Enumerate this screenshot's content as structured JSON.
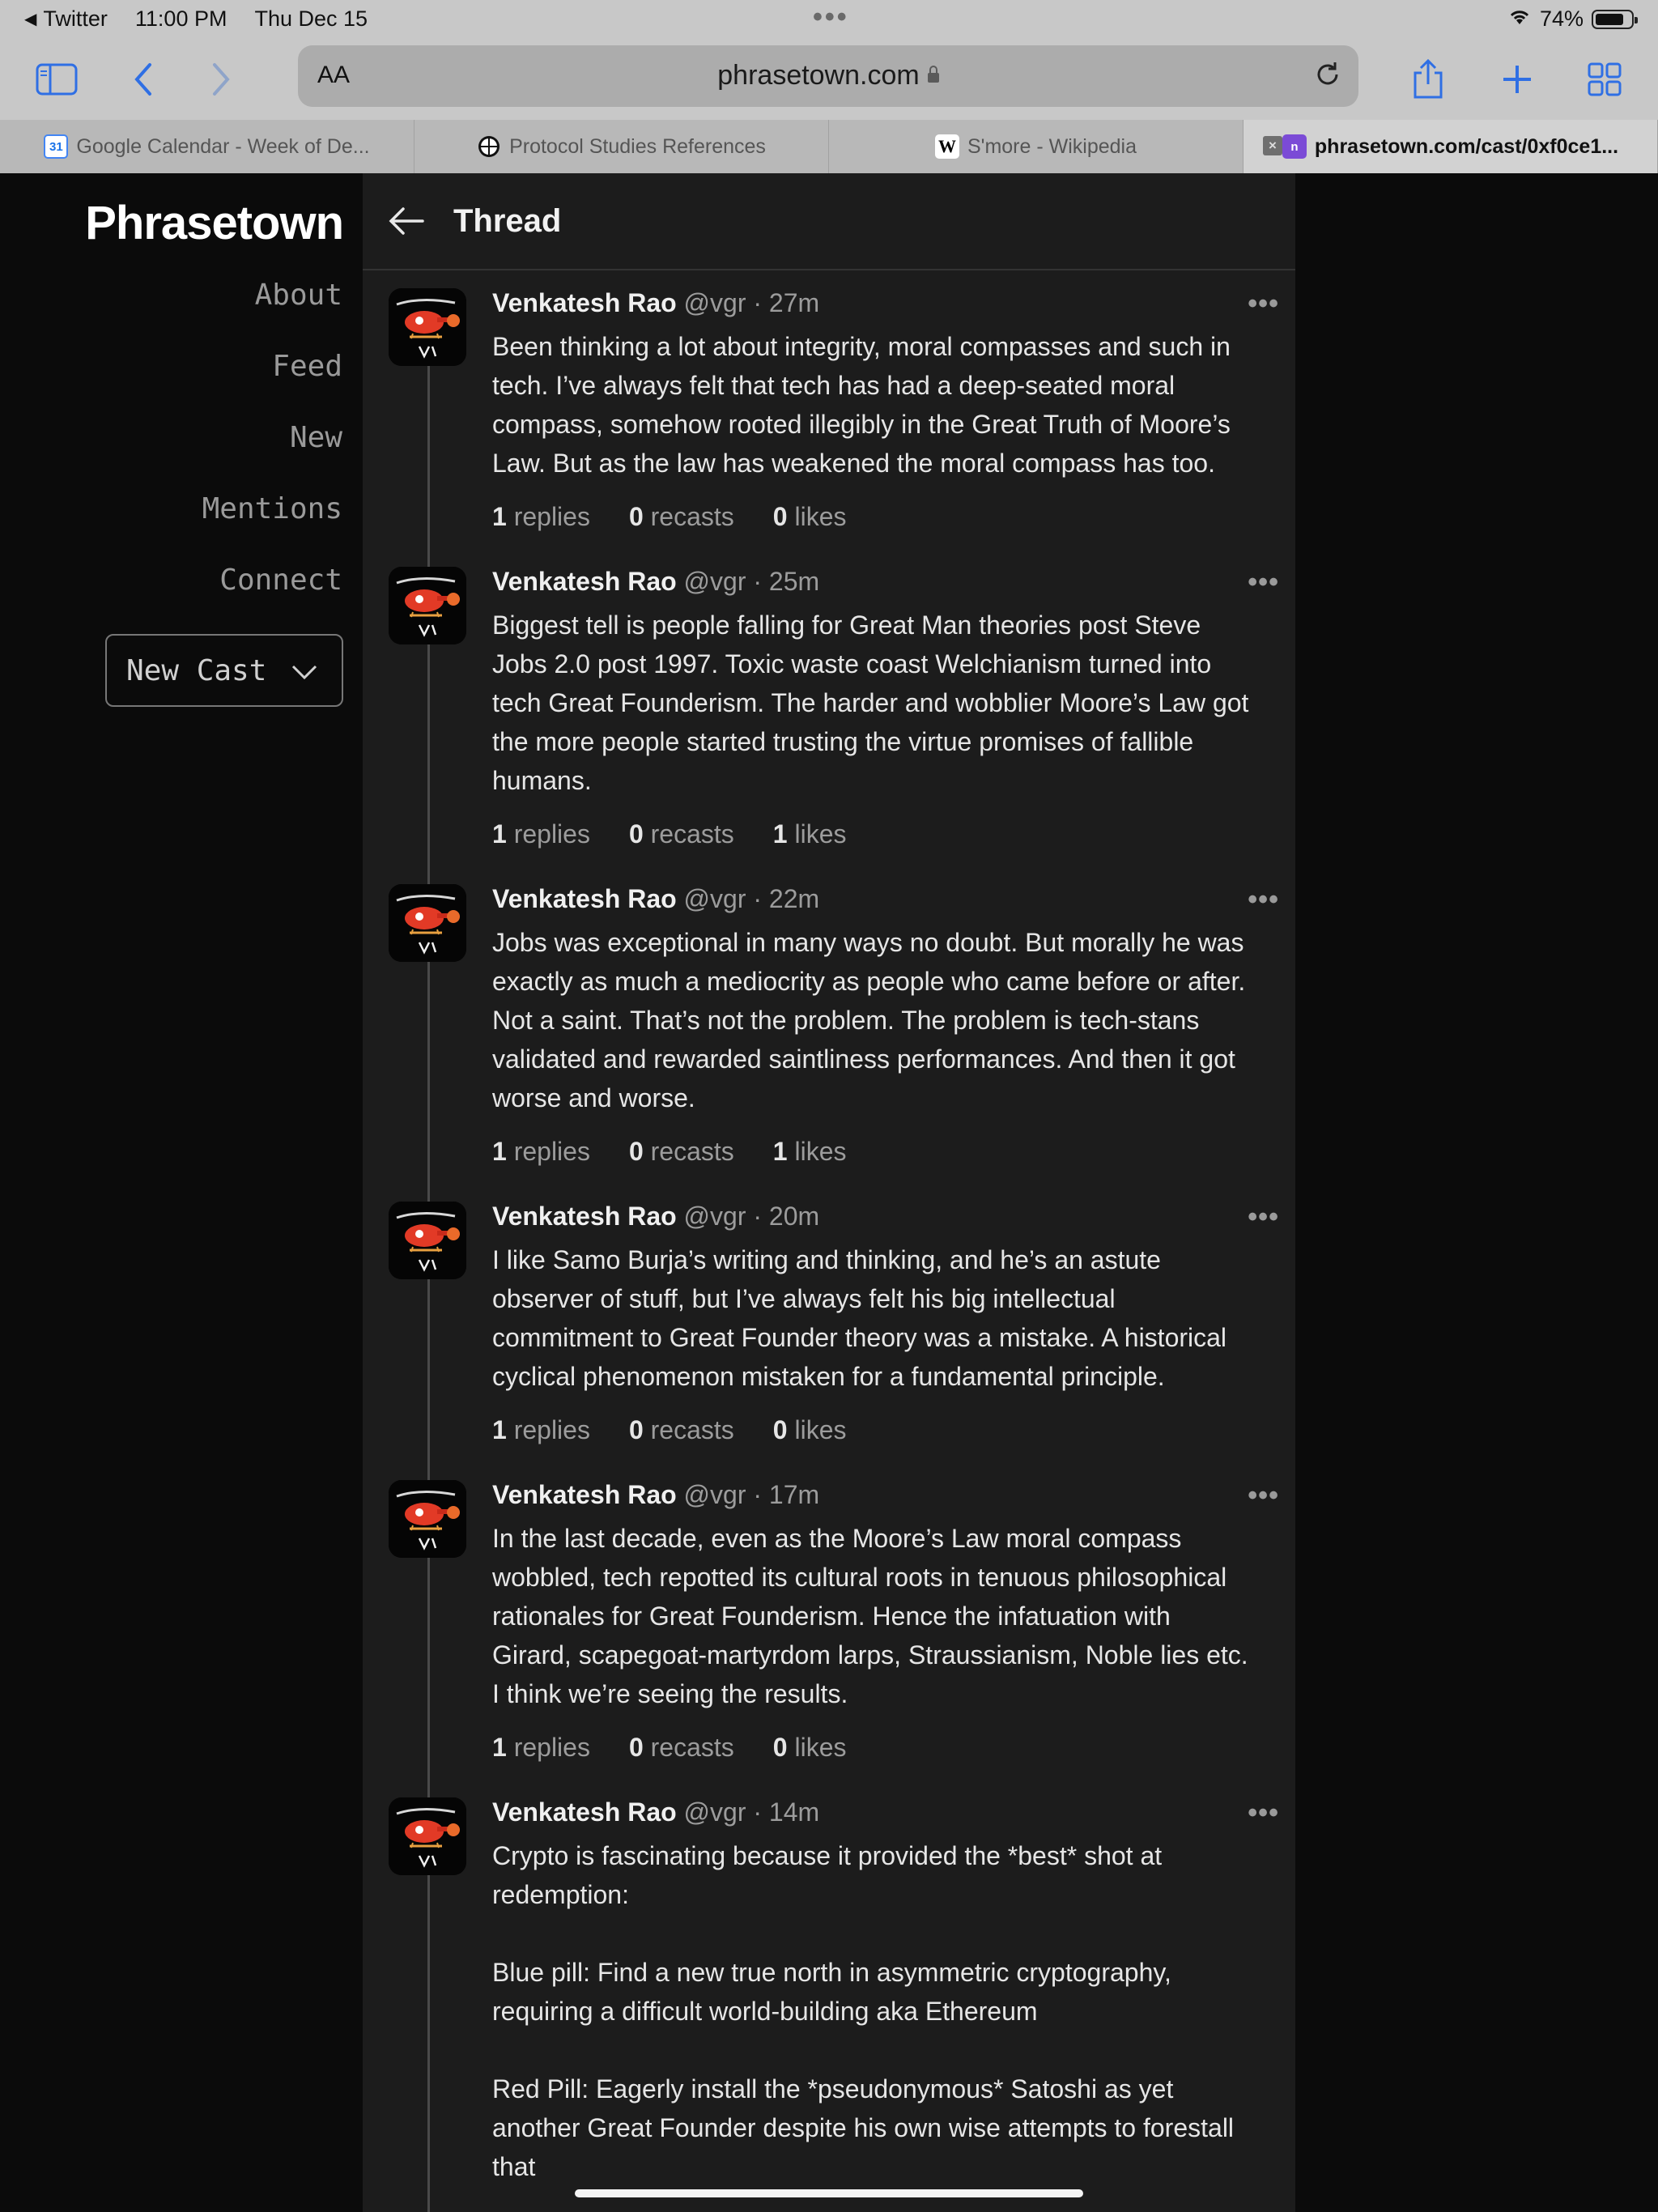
{
  "status_bar": {
    "back_app": "Twitter",
    "time": "11:00 PM",
    "date": "Thu Dec 15",
    "battery": "74%"
  },
  "toolbar": {
    "aa_label": "AA",
    "url": "phrasetown.com"
  },
  "tabs": [
    {
      "title": "Google Calendar - Week of De...",
      "favicon": "31"
    },
    {
      "title": "Protocol Studies References",
      "favicon": "globe"
    },
    {
      "title": "S'more - Wikipedia",
      "favicon": "W"
    },
    {
      "title": "phrasetown.com/cast/0xf0ce1...",
      "favicon": "n"
    }
  ],
  "sidebar": {
    "logo": "Phrasetown",
    "nav": [
      "About",
      "Feed",
      "New",
      "Mentions",
      "Connect"
    ],
    "new_cast_label": "New Cast"
  },
  "thread": {
    "title": "Thread",
    "posts": [
      {
        "name": "Venkatesh Rao",
        "handle": "@vgr",
        "time": "27m",
        "text": "Been thinking a lot about integrity, moral compasses and such in\ntech. I’ve always felt that tech has had a deep-seated moral\ncompass, somehow rooted illegibly in the Great Truth of Moore’s\nLaw. But as the law has weakened the moral compass has too.",
        "replies": "1",
        "recasts": "0",
        "likes": "0"
      },
      {
        "name": "Venkatesh Rao",
        "handle": "@vgr",
        "time": "25m",
        "text": "Biggest tell is people falling for Great Man theories post Steve\nJobs 2.0 post 1997. Toxic waste coast Welchianism turned into\ntech Great Founderism. The harder and wobblier Moore’s Law got\nthe more people started trusting the virtue promises of fallible\nhumans.",
        "replies": "1",
        "recasts": "0",
        "likes": "1"
      },
      {
        "name": "Venkatesh Rao",
        "handle": "@vgr",
        "time": "22m",
        "text": "Jobs was exceptional in many ways no doubt. But morally he was\nexactly as much a mediocrity as people who came before or after.\nNot a saint. That’s not the problem. The problem is tech-stans\nvalidated and rewarded saintliness performances. And then it got\nworse and worse.",
        "replies": "1",
        "recasts": "0",
        "likes": "1"
      },
      {
        "name": "Venkatesh Rao",
        "handle": "@vgr",
        "time": "20m",
        "text": "I like Samo Burja’s writing and thinking, and he’s an astute\nobserver of stuff, but I’ve always felt his big intellectual\ncommitment to Great Founder theory was a mistake. A historical\ncyclical phenomenon mistaken for a fundamental principle.",
        "replies": "1",
        "recasts": "0",
        "likes": "0"
      },
      {
        "name": "Venkatesh Rao",
        "handle": "@vgr",
        "time": "17m",
        "text": "In the last decade, even as the Moore’s Law moral compass\nwobbled, tech repotted its cultural roots in tenuous philosophical\nrationales for Great Founderism. Hence the infatuation with\nGirard, scapegoat-martyrdom larps, Straussianism, Noble lies etc.\nI think we’re seeing the results.",
        "replies": "1",
        "recasts": "0",
        "likes": "0"
      },
      {
        "name": "Venkatesh Rao",
        "handle": "@vgr",
        "time": "14m",
        "text": "Crypto is fascinating because it provided the *best* shot at\nredemption:\n\nBlue pill: Find a new true north in asymmetric cryptography,\nrequiring a difficult world-building aka Ethereum\n\nRed Pill: Eagerly install the *pseudonymous* Satoshi as yet\nanother Great Founder despite his own wise attempts to forestall\nthat",
        "replies": "",
        "recasts": "",
        "likes": ""
      }
    ],
    "stat_labels": {
      "replies": "replies",
      "recasts": "recasts",
      "likes": "likes"
    }
  },
  "colors": {
    "accent": "#2f6fe4",
    "background": "#0b0b0b",
    "panel": "#1c1c1c"
  }
}
